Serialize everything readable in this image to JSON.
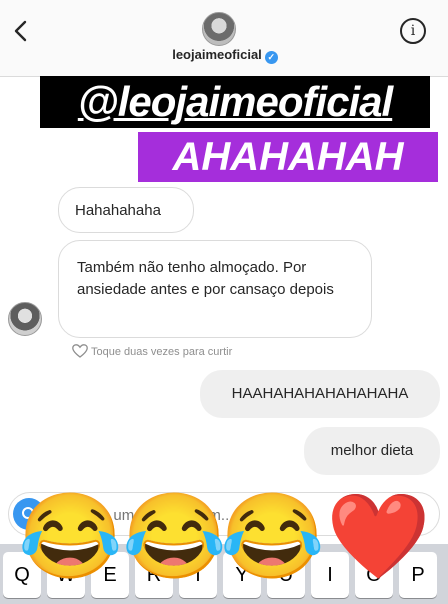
{
  "header": {
    "username": "leojaimeoficial",
    "verified_icon": "verified-badge-icon",
    "back_icon": "chevron-left-icon",
    "info_icon": "info-icon"
  },
  "stickers": [
    {
      "text": "@leojaimeoficial",
      "background": "#000000",
      "color": "#ffffff"
    },
    {
      "text": "AHAHAHAH",
      "background": "#a52edb",
      "color": "#ffffff"
    }
  ],
  "messages": {
    "incoming": [
      {
        "text": "Hahahahaha"
      },
      {
        "text": "Também não tenho almoçado. Por ansiedade antes e por cansaço depois"
      }
    ],
    "like_hint": "Toque duas vezes para curtir",
    "outgoing": [
      {
        "text": "HAAHAHAHAHAHAHAHA"
      },
      {
        "text": "melhor dieta"
      }
    ]
  },
  "composer": {
    "placeholder": "Escreva uma mensagem...",
    "camera_icon": "camera-icon"
  },
  "keyboard": {
    "keys": [
      "Q",
      "W",
      "E",
      "R",
      "T",
      "Y",
      "U",
      "I",
      "O",
      "P"
    ]
  },
  "emojis": [
    "😂",
    "😂",
    "😂",
    "❤️"
  ],
  "colors": {
    "accent": "#3897f0",
    "outgoing_bubble": "#efefef",
    "sticker_purple": "#a52edb"
  }
}
